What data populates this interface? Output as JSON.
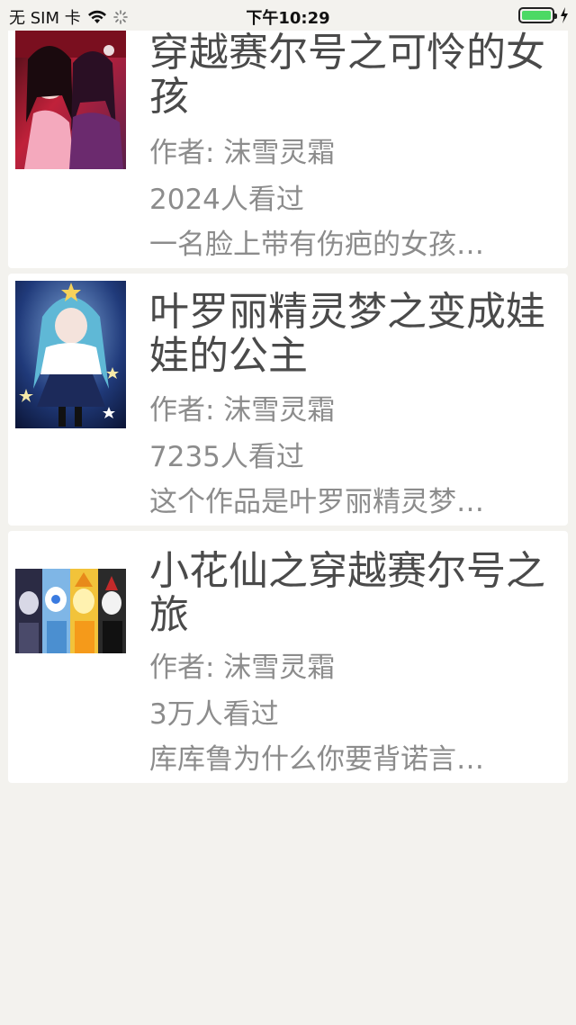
{
  "status_bar": {
    "carrier": "无 SIM 卡",
    "time": "下午10:29"
  },
  "books": [
    {
      "title": "穿越赛尔号之可怜的女孩",
      "author": "作者: 沫雪灵霜",
      "views": "2024人看过",
      "summary": "一名脸上带有伤疤的女孩…"
    },
    {
      "title": "叶罗丽精灵梦之变成娃娃的公主",
      "author": "作者: 沫雪灵霜",
      "views": "7235人看过",
      "summary": "这个作品是叶罗丽精灵梦…"
    },
    {
      "title": "小花仙之穿越赛尔号之旅",
      "author": "作者: 沫雪灵霜",
      "views": "3万人看过",
      "summary": "库库鲁为什么你要背诺言…"
    }
  ]
}
